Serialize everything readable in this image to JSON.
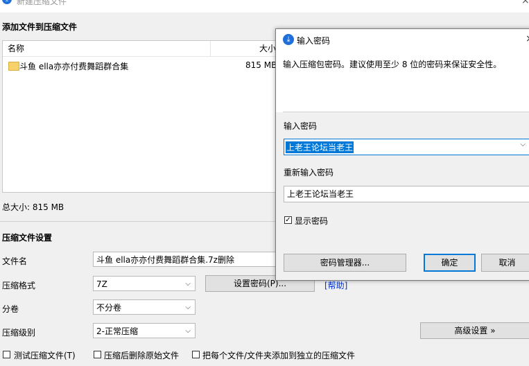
{
  "window": {
    "title": "新建压缩文件",
    "close_glyph": "×"
  },
  "add_files": {
    "section_title": "添加文件到压缩文件",
    "columns": {
      "name": "名称",
      "size": "大小"
    },
    "files": [
      {
        "name": "斗鱼 ella亦亦付费舞蹈群合集",
        "size": "815 MB"
      }
    ],
    "total_size": "总大小: 815 MB"
  },
  "settings": {
    "section_title": "压缩文件设置",
    "filename_label": "文件名",
    "filename_value": "斗鱼 ella亦亦付费舞蹈群合集.7z删除",
    "format_label": "压缩格式",
    "format_value": "7Z",
    "set_password_button": "设置密码(P)...",
    "help_link": "[帮助]",
    "volume_label": "分卷",
    "volume_value": "不分卷",
    "level_label": "压缩级别",
    "level_value": "2-正常压缩",
    "advanced_button": "高级设置 »",
    "options": [
      {
        "label": "测试压缩文件(T)",
        "checked": false
      },
      {
        "label": "压缩后删除原始文件",
        "checked": false
      },
      {
        "label": "把每个文件/文件夹添加到独立的压缩文件",
        "checked": false
      }
    ]
  },
  "dialog": {
    "title": "输入密码",
    "close_glyph": "×",
    "hint": "输入压缩包密码。建议使用至少 8 位的密码来保证安全性。",
    "password_label": "输入密码",
    "password_value": "上老王论坛当老王",
    "confirm_label": "重新输入密码",
    "confirm_value": "上老王论坛当老王",
    "show_password_label": "显示密码",
    "show_password_checked": true,
    "password_manager_button": "密码管理器...",
    "ok_button": "确定",
    "cancel_button": "取消"
  },
  "icons": {
    "app": "7zip-icon",
    "folder": "folder-icon",
    "chevron": "chevron-down-icon",
    "check": "checkmark-icon"
  },
  "colors": {
    "accent": "#1e6fd9",
    "selection": "#0078d7",
    "link": "#0033cc"
  }
}
